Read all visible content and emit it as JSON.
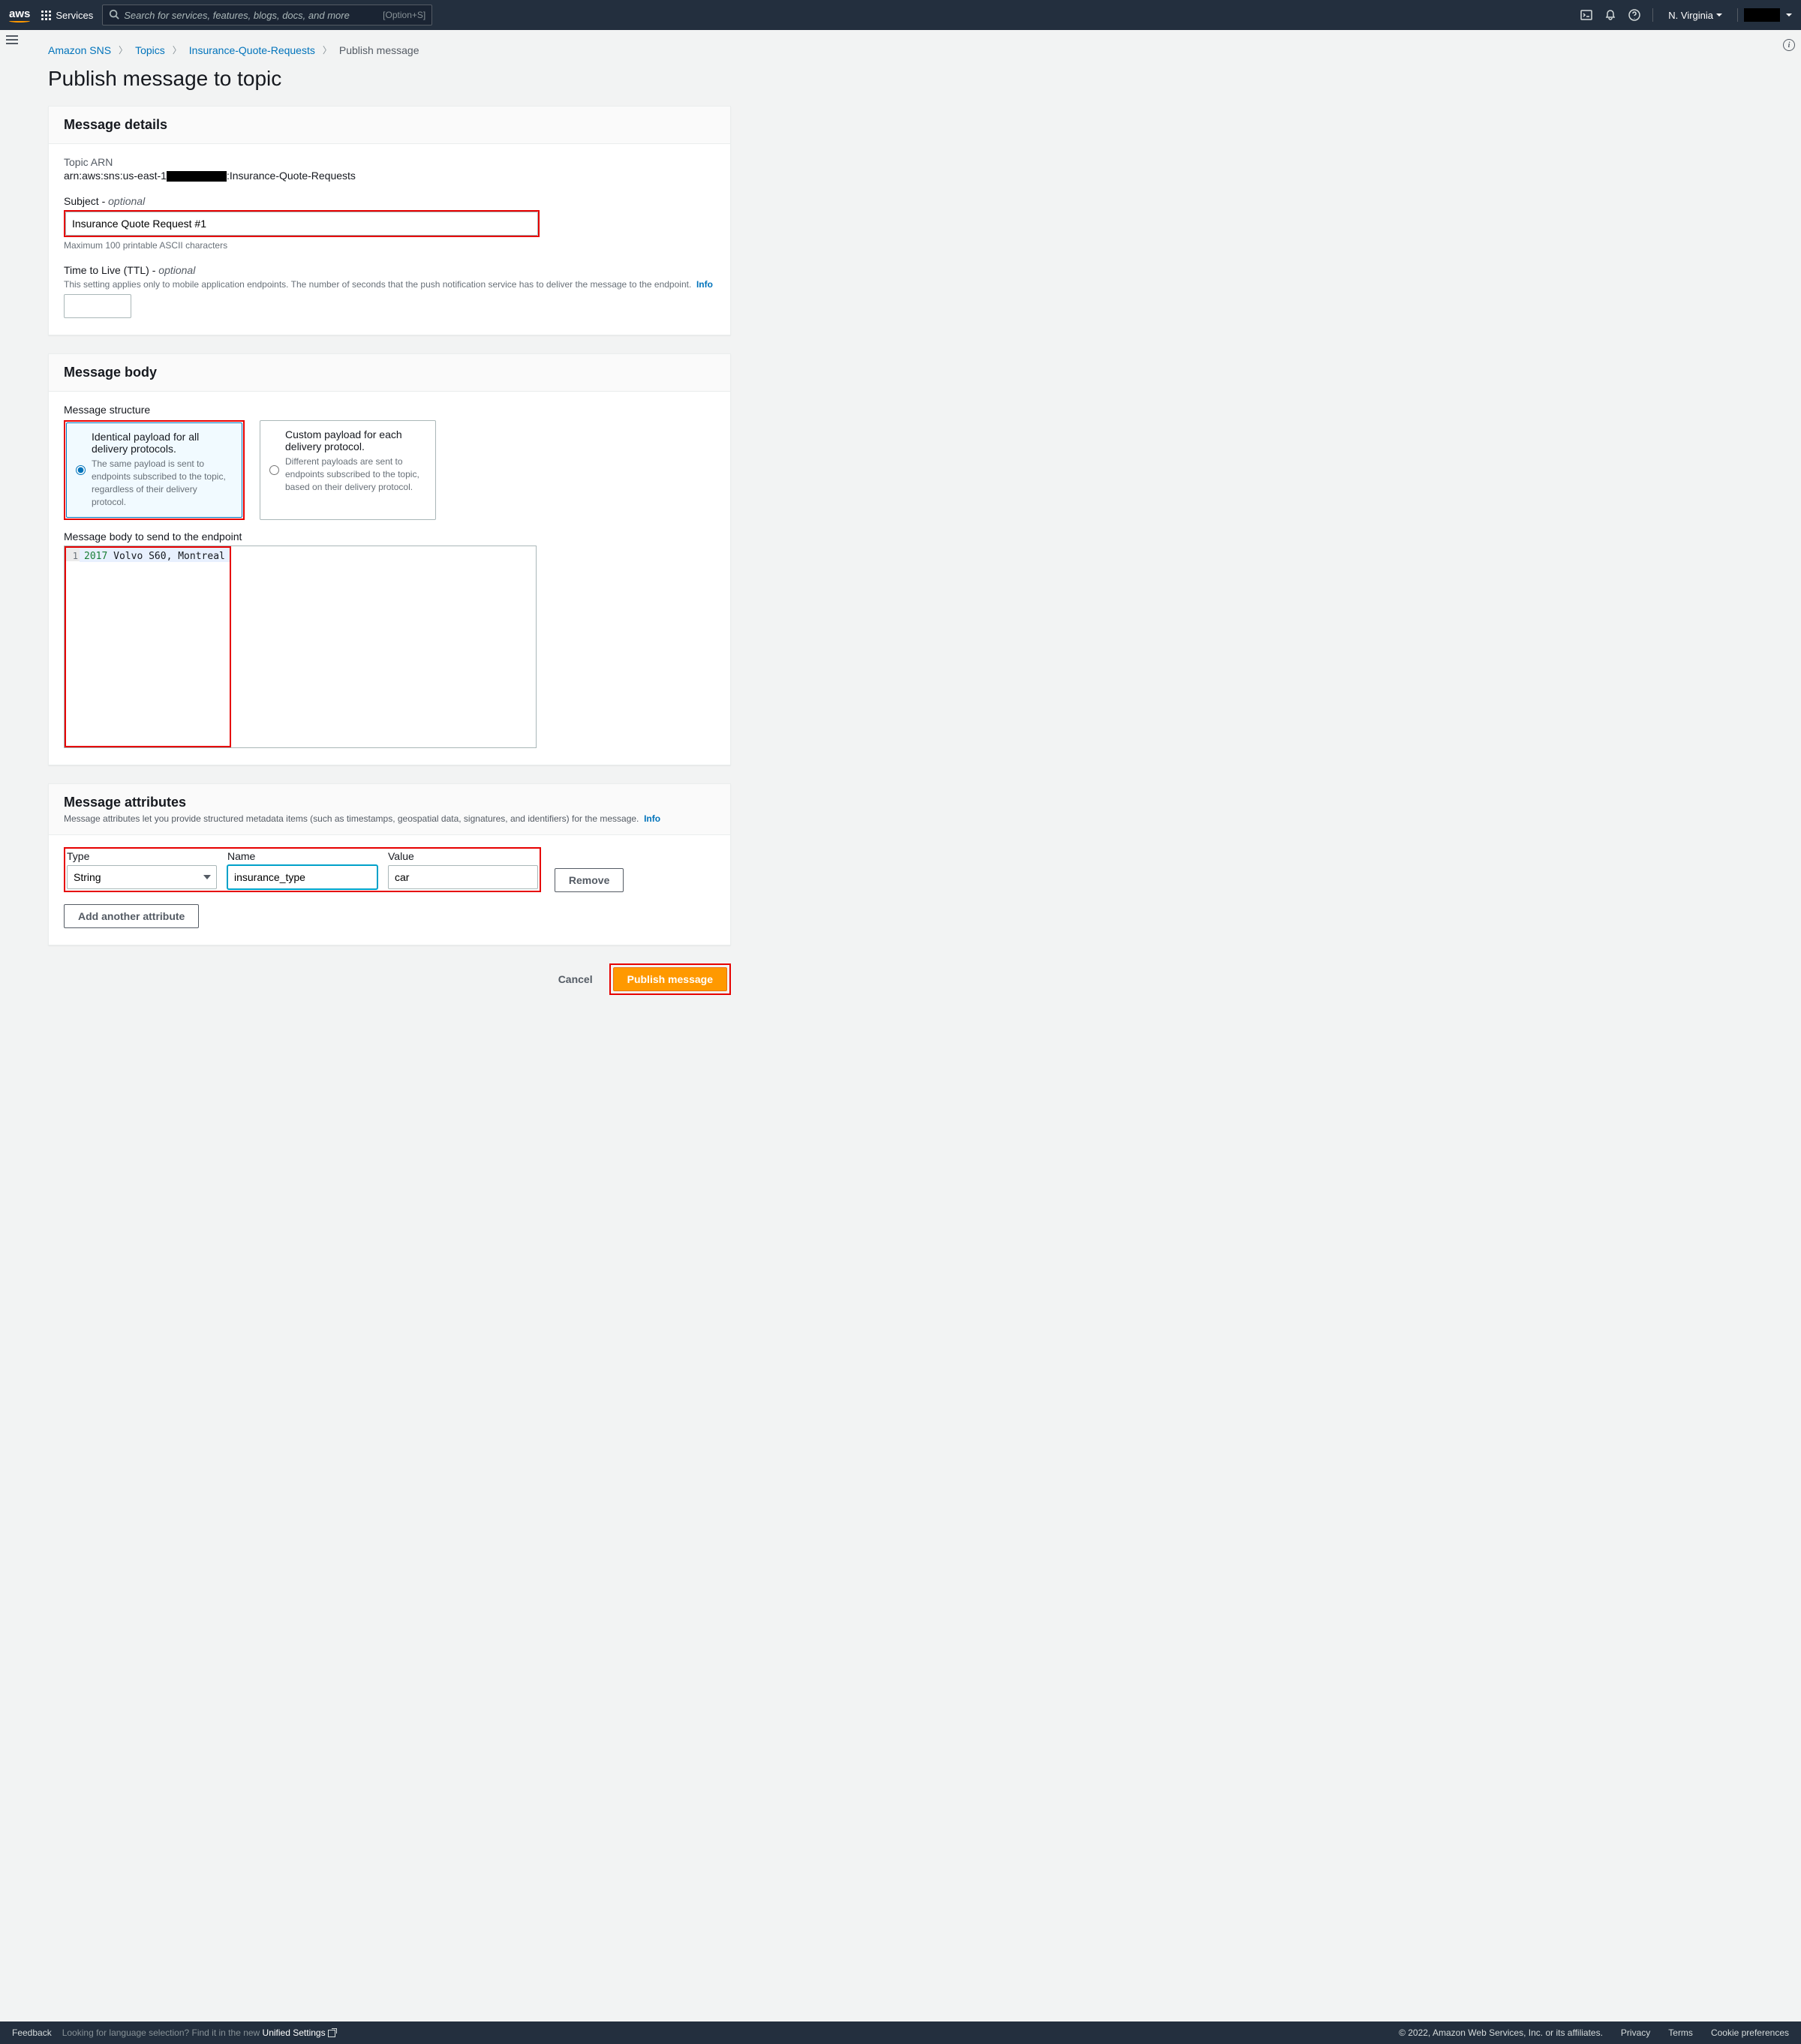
{
  "nav": {
    "services_label": "Services",
    "search_placeholder": "Search for services, features, blogs, docs, and more",
    "search_shortcut": "[Option+S]",
    "region": "N. Virginia"
  },
  "breadcrumb": {
    "items": [
      "Amazon SNS",
      "Topics",
      "Insurance-Quote-Requests"
    ],
    "current": "Publish message"
  },
  "page_title": "Publish message to topic",
  "details": {
    "header": "Message details",
    "arn_label": "Topic ARN",
    "arn_prefix": "arn:aws:sns:us-east-1",
    "arn_suffix": ":Insurance-Quote-Requests",
    "subject_label": "Subject - ",
    "subject_optional": "optional",
    "subject_value": "Insurance Quote Request #1",
    "subject_hint": "Maximum 100 printable ASCII characters",
    "ttl_label": "Time to Live (TTL) - ",
    "ttl_optional": "optional",
    "ttl_hint": "This setting applies only to mobile application endpoints. The number of seconds that the push notification service has to deliver the message to the endpoint.",
    "info_link": "Info"
  },
  "body_panel": {
    "header": "Message body",
    "structure_label": "Message structure",
    "radio1_title": "Identical payload for all delivery protocols.",
    "radio1_sub": "The same payload is sent to endpoints subscribed to the topic, regardless of their delivery protocol.",
    "radio2_title": "Custom payload for each delivery protocol.",
    "radio2_sub": "Different payloads are sent to endpoints subscribed to the topic, based on their delivery protocol.",
    "body_label": "Message body to send to the endpoint",
    "line_num": "1",
    "code_year": "2017",
    "code_rest": " Volvo S60, Montreal"
  },
  "attrs": {
    "header": "Message attributes",
    "desc": "Message attributes let you provide structured metadata items (such as timestamps, geospatial data, signatures, and identifiers) for the message.",
    "info_link": "Info",
    "type_label": "Type",
    "name_label": "Name",
    "value_label": "Value",
    "type_value": "String",
    "name_value": "insurance_type",
    "value_value": "car",
    "remove_label": "Remove",
    "add_label": "Add another attribute"
  },
  "actions": {
    "cancel": "Cancel",
    "publish": "Publish message"
  },
  "footer": {
    "feedback": "Feedback",
    "lang_text": "Looking for language selection? Find it in the new ",
    "unified": "Unified Settings",
    "copyright": "© 2022, Amazon Web Services, Inc. or its affiliates.",
    "privacy": "Privacy",
    "terms": "Terms",
    "cookie": "Cookie preferences"
  }
}
